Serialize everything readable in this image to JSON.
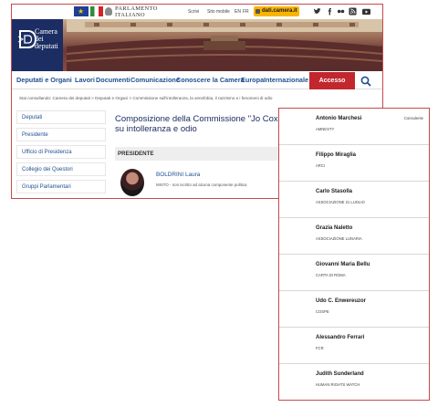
{
  "topbar": {
    "parliament_logo_line1": "PARLAMENTO",
    "parliament_logo_line2": "ITALIANO",
    "scrivi": "Scrivi",
    "site_mobile": "Sito mobile",
    "lang_en": "EN",
    "lang_fr": "FR",
    "dati_link": "dati.camera.it",
    "social": [
      "twitter-icon",
      "facebook-icon",
      "flickr-icon",
      "rss-icon",
      "youtube-icon"
    ]
  },
  "logo": {
    "line1": "Camera",
    "line2": "dei",
    "line3": "deputati"
  },
  "nav": {
    "items": [
      "Deputati e Organi",
      "Lavori",
      "Documenti",
      "Comunicazione",
      "Conoscere la Camera",
      "Europa",
      "Internazionale"
    ],
    "accesso_rapido": "Accesso rapido"
  },
  "breadcrumb": "Stai consultando: Camera dei deputati > Deputati e Organi > Commissione sull'intolleranza, la xenofobia, il razzismo e i fenomeni di odio",
  "sidebar": [
    "Deputati",
    "Presidente",
    "Ufficio di Presidenza",
    "Collegio dei Questori",
    "Gruppi Parlamentari"
  ],
  "main": {
    "title_line1": "Composizione della Commissione \"Jo Cox\"",
    "title_line2": "su intolleranza e odio",
    "section": "PRESIDENTE",
    "member_name": "BOLDRINI Laura",
    "member_group": "MISTO - non iscritto ad alcuna componente politica"
  },
  "overlay": [
    {
      "name": "Antonio Marchesi",
      "org": "AMNESTY",
      "role": "Consulente"
    },
    {
      "name": "Filippo Miraglia",
      "org": "ARCI",
      "role": ""
    },
    {
      "name": "Carlo Stasolla",
      "org": "ASSOCIAZIONE 21 LUGLIO",
      "role": ""
    },
    {
      "name": "Grazia Naletto",
      "org": "ASSOCIAZIONE LUNARIA",
      "role": ""
    },
    {
      "name": "Giovanni Maria Bellu",
      "org": "CARTA DI ROMA",
      "role": ""
    },
    {
      "name": "Udo C. Enwereuzor",
      "org": "COSPE",
      "role": ""
    },
    {
      "name": "Alessandro Ferrari",
      "org": "FCR",
      "role": ""
    },
    {
      "name": "Judith Sunderland",
      "org": "HUMAN RIGHTS WATCH",
      "role": ""
    }
  ],
  "colors": {
    "brand_navy": "#1c2d63",
    "nav_blue": "#1d4f91",
    "accent_red": "#c1272d",
    "dati_yellow": "#f7b500"
  }
}
